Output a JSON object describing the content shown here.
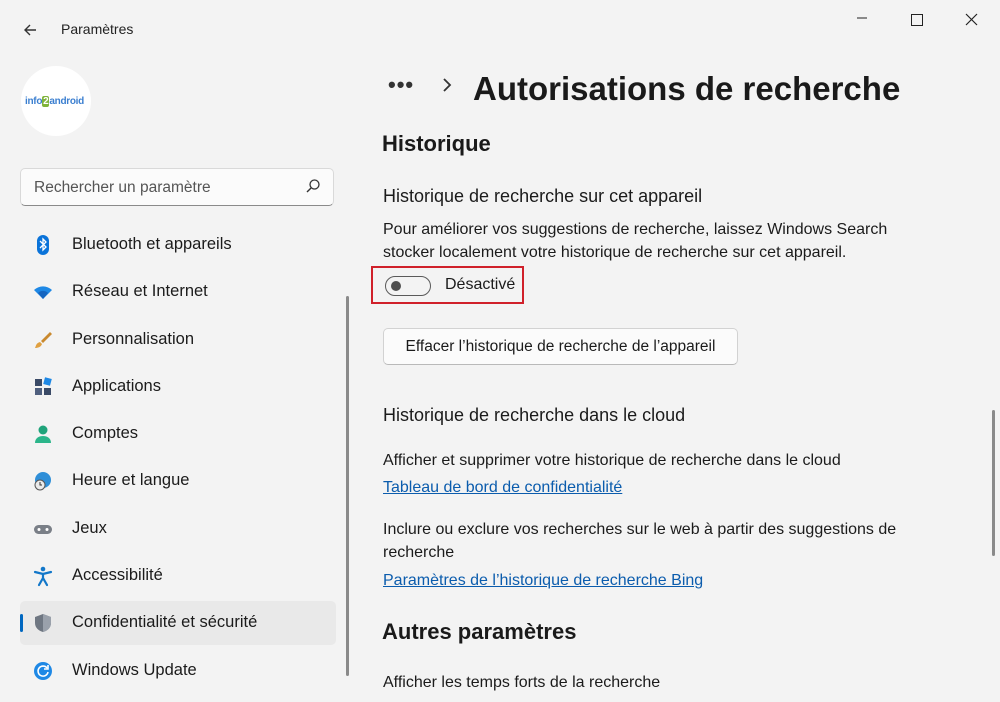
{
  "window": {
    "title": "Paramètres",
    "back_icon": "back-arrow-icon",
    "logo_text_1": "info",
    "logo_text_2": "android"
  },
  "search": {
    "placeholder": "Rechercher un paramètre"
  },
  "nav": {
    "items": [
      {
        "label": "Bluetooth et appareils",
        "icon": "bluetooth-icon"
      },
      {
        "label": "Réseau et Internet",
        "icon": "wifi-icon"
      },
      {
        "label": "Personnalisation",
        "icon": "brush-icon"
      },
      {
        "label": "Applications",
        "icon": "apps-icon"
      },
      {
        "label": "Comptes",
        "icon": "account-icon"
      },
      {
        "label": "Heure et langue",
        "icon": "globe-clock-icon"
      },
      {
        "label": "Jeux",
        "icon": "gamepad-icon"
      },
      {
        "label": "Accessibilité",
        "icon": "accessibility-icon"
      },
      {
        "label": "Confidentialité et sécurité",
        "icon": "shield-icon",
        "active": true
      },
      {
        "label": "Windows Update",
        "icon": "update-icon"
      }
    ]
  },
  "header": {
    "breadcrumb_more": "•••",
    "page_title": "Autorisations de recherche"
  },
  "history": {
    "heading": "Historique",
    "device": {
      "title": "Historique de recherche sur cet appareil",
      "desc_line1": "Pour améliorer vos suggestions de recherche, laissez Windows Search",
      "desc_line2": "stocker localement votre historique de recherche sur cet appareil.",
      "toggle_label": "Désactivé",
      "toggle_on": false,
      "clear_button": "Effacer l’historique de recherche de l’appareil"
    },
    "cloud": {
      "title": "Historique de recherche dans le cloud",
      "view_text": "Afficher et supprimer votre historique de recherche dans le cloud",
      "privacy_link": "Tableau de bord de confidentialité",
      "include_line1": "Inclure ou exclure vos recherches sur le web à partir des suggestions de",
      "include_line2": "recherche",
      "bing_link": "Paramètres de l’historique de recherche Bing"
    }
  },
  "other": {
    "heading": "Autres paramètres",
    "highlights": "Afficher les temps forts de la recherche"
  },
  "colors": {
    "accent": "#0067c0",
    "highlight_box": "#d0202a",
    "link": "#0b5cad"
  }
}
